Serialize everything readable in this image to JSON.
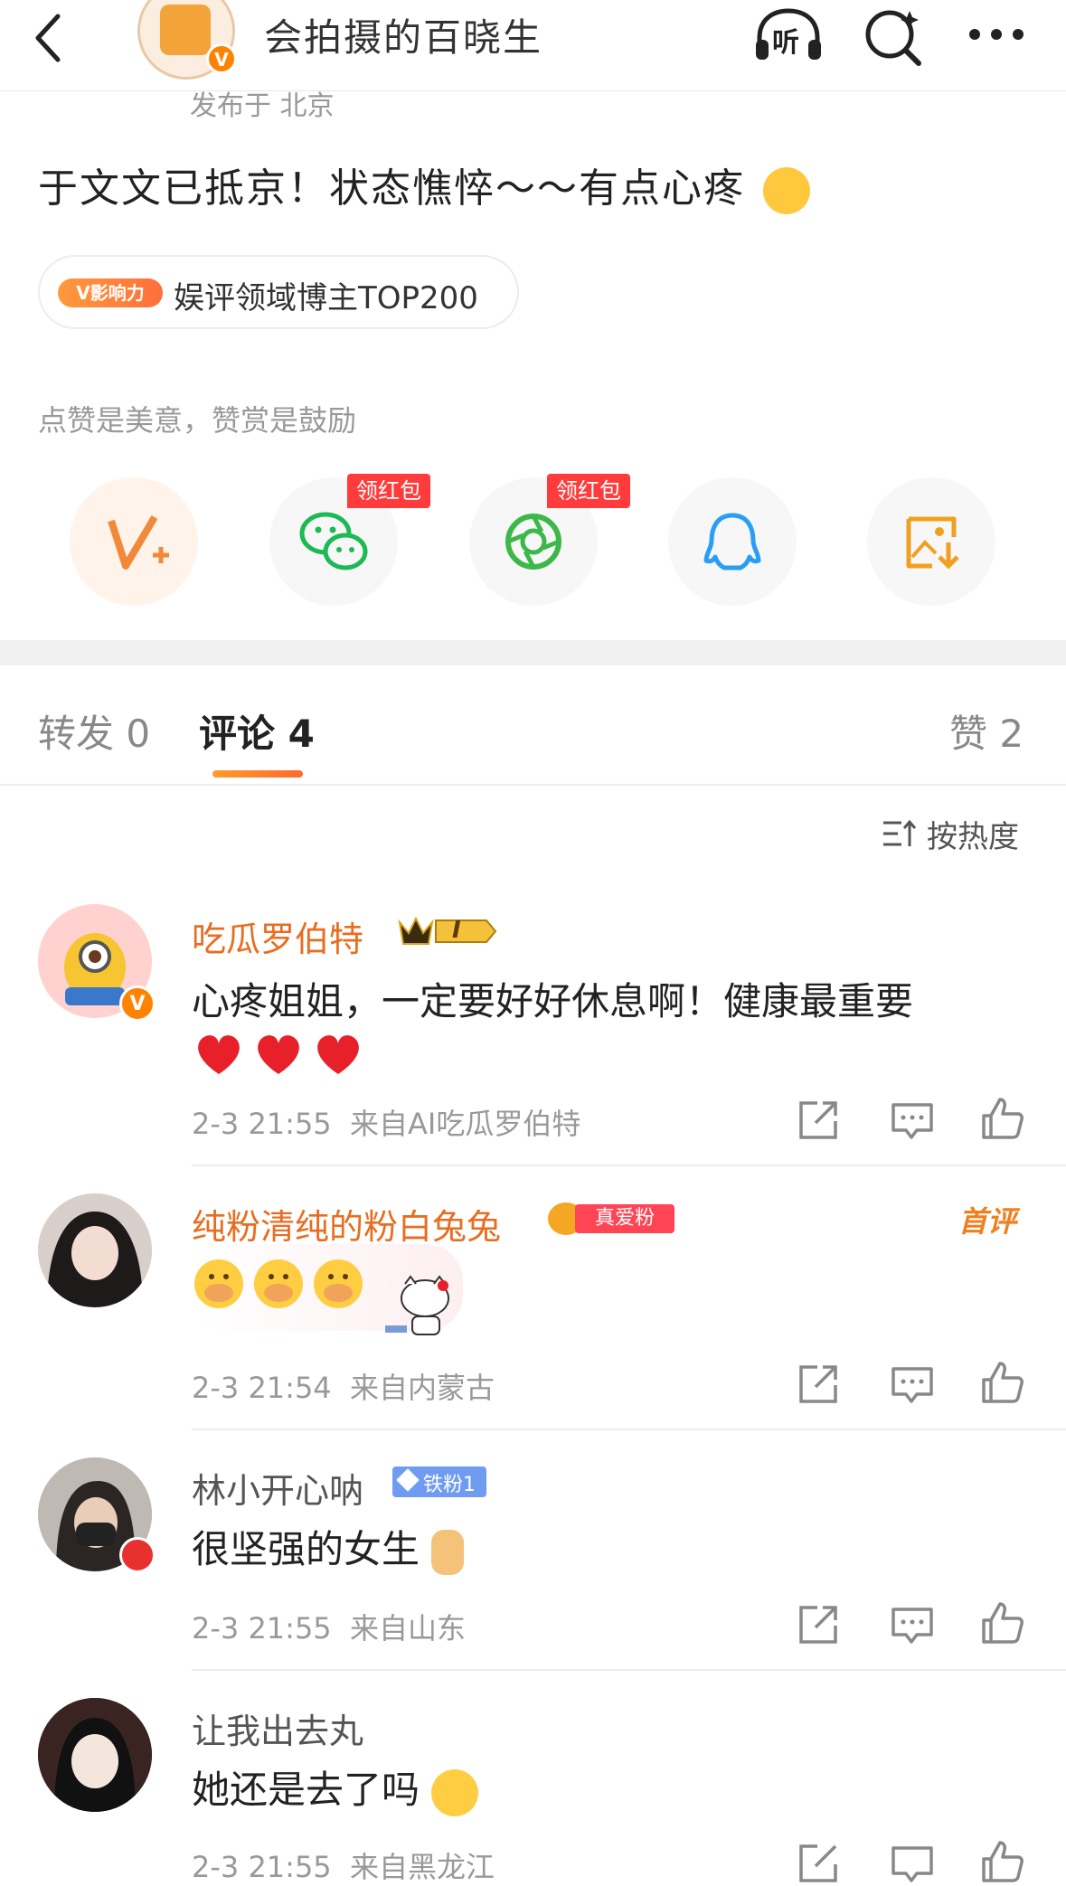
{
  "header": {
    "title": "会拍摄的百晓生",
    "back_icon": "chevron-left-icon",
    "listen_label": "听",
    "search_icon": "search-icon",
    "more_icon": "more-icon",
    "verified_mark": "V"
  },
  "post": {
    "location": "发布于 北京",
    "text": "于文文已抵京！状态憔悴～～有点心疼",
    "influence_tag": "V影响力",
    "influence_text": "娱评领域博主TOP200",
    "reward_text": "点赞是美意，赞赏是鼓励",
    "share_badges": [
      "领红包",
      "领红包"
    ]
  },
  "tabs": {
    "repost": "转发 0",
    "comments": "评论 4",
    "likes": "赞 2"
  },
  "sort_label": "按热度",
  "comments": [
    {
      "name": "吃瓜罗伯特",
      "name_color": "#e86d20",
      "badge": "I",
      "text": "心疼姐姐，一定要好好休息啊！健康最重要",
      "meta": "2-3 21:55  来自AI吃瓜罗伯特"
    },
    {
      "name": "纯粉清纯的粉白兔兔",
      "name_color": "#e86d20",
      "badge": "真爱粉",
      "first_label": "首评",
      "meta": "2-3 21:54  来自内蒙古"
    },
    {
      "name": "林小开心呐",
      "name_color": "#555555",
      "badge": "铁粉1",
      "text": "很坚强的女生",
      "meta": "2-3 21:55  来自山东"
    },
    {
      "name": "让我出去丸",
      "name_color": "#555555",
      "text": "她还是去了吗",
      "meta": "2-3 21:55  来自黑龙江"
    }
  ]
}
